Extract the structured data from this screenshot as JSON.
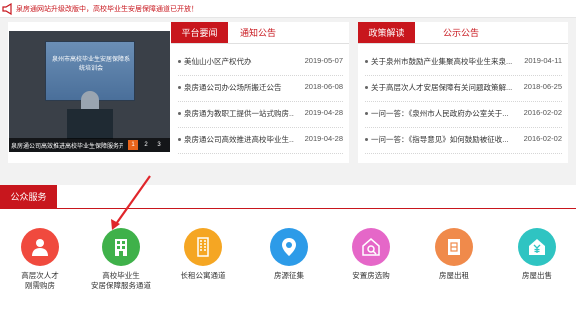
{
  "notice": {
    "text": "泉房通网站升级改版中，高校毕业生安居保障通道已开放！"
  },
  "slider": {
    "screen_title": "泉州市高校毕业生安居保障系统培训会",
    "caption": "泉房通公司高效推进高校毕业生保障服务开放",
    "dots": [
      "1",
      "2",
      "3"
    ]
  },
  "left_panel": {
    "tabs": [
      "平台要闻",
      "通知公告"
    ],
    "news": [
      {
        "title": "美仙山小区产权代办",
        "date": "2019-05-07"
      },
      {
        "title": "泉房通公司办公场所搬迁公告",
        "date": "2018-06-08"
      },
      {
        "title": "泉房通为教职工提供一站式购房...",
        "date": "2019-04-28"
      },
      {
        "title": "泉房通公司高效推进高校毕业生...",
        "date": "2019-04-28"
      }
    ]
  },
  "right_panel": {
    "tabs": [
      "政策解读",
      "公示公告"
    ],
    "news": [
      {
        "title": "关于泉州市鼓励产业集聚高校毕业生来泉...",
        "date": "2019-04-11"
      },
      {
        "title": "关于高层次人才安居保障有关问题政策解...",
        "date": "2018-06-25"
      },
      {
        "title": "一问一答：《泉州市人民政府办公室关于...",
        "date": "2016-02-02"
      },
      {
        "title": "一问一答：《指导意见》如何鼓励被征收...",
        "date": "2016-02-02"
      }
    ]
  },
  "services": {
    "title": "公众服务",
    "items": [
      {
        "label1": "高层次人才",
        "label2": "刚需购房",
        "color": "#f04a3e",
        "icon": "person-icon"
      },
      {
        "label1": "高校毕业生",
        "label2": "安居保障服务通道",
        "color": "#3fb14a",
        "icon": "building-icon"
      },
      {
        "label1": "长租公寓通道",
        "label2": "",
        "color": "#f5a623",
        "icon": "apartment-icon"
      },
      {
        "label1": "房源征集",
        "label2": "",
        "color": "#2d9be8",
        "icon": "location-icon"
      },
      {
        "label1": "安置房选购",
        "label2": "",
        "color": "#e567c8",
        "icon": "house-search-icon"
      },
      {
        "label1": "房屋出租",
        "label2": "",
        "color": "#f08a4b",
        "icon": "rent-document-icon"
      },
      {
        "label1": "房屋出售",
        "label2": "",
        "color": "#2fc4c2",
        "icon": "sale-yen-icon"
      }
    ]
  }
}
